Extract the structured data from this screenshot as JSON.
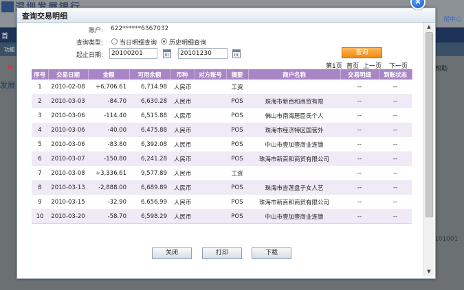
{
  "background": {
    "brand_text": "深圳发展银行",
    "nav_text": "首",
    "sub_text": "功能",
    "left_title": "发展",
    "right_help": "帮助",
    "right_center": "帮中心",
    "right_number": "101001"
  },
  "dialog": {
    "title": "查询交易明细",
    "close_icon": "×"
  },
  "form": {
    "account_label": "账户:",
    "account_value": "622******6367032",
    "query_type_label": "查询类型:",
    "query_type_options": [
      "当日明细查询",
      "历史明细查询"
    ],
    "query_type_selected": "历史明细查询",
    "date_label": "起止日期:",
    "start_date": "20100201",
    "date_separator": "-",
    "end_date": "20101230",
    "query_button": "查询"
  },
  "pager": {
    "current": "第1页",
    "first": "首页",
    "prev": "上一页",
    "next": "下一页"
  },
  "table": {
    "headers": [
      "序号",
      "交易日期",
      "金额",
      "可用余额",
      "币种",
      "对方账号",
      "摘要",
      "商户名称",
      "交易明细",
      "到账状态"
    ],
    "rows": [
      [
        "1",
        "2010-02-08",
        "+6,706.61",
        "6,714.98",
        "人民币",
        "",
        "工资",
        "",
        "--",
        "--"
      ],
      [
        "2",
        "2010-03-03",
        "-84.70",
        "6,630.28",
        "人民币",
        "",
        "POS",
        "珠海市新百和商贸有限",
        "--",
        "--"
      ],
      [
        "3",
        "2010-03-06",
        "-114.40",
        "6,515.88",
        "人民币",
        "",
        "POS",
        "佛山市南海居臣氏个人",
        "--",
        "--"
      ],
      [
        "4",
        "2010-03-06",
        "-40.00",
        "6,475.88",
        "人民币",
        "",
        "POS",
        "珠海市经济特区国营外",
        "--",
        "--"
      ],
      [
        "5",
        "2010-03-06",
        "-83.80",
        "6,392.08",
        "人民币",
        "",
        "POS",
        "中山市壹加壹商业连锁",
        "--",
        "--"
      ],
      [
        "6",
        "2010-03-07",
        "-150.80",
        "6,241.28",
        "人民币",
        "",
        "POS",
        "珠海市新百和商贸有限公司",
        "--",
        "--"
      ],
      [
        "7",
        "2010-03-08",
        "+3,336.61",
        "9,577.89",
        "人民币",
        "",
        "工资",
        "",
        "--",
        "--"
      ],
      [
        "8",
        "2010-03-13",
        "-2,888.00",
        "6,689.89",
        "人民币",
        "",
        "POS",
        "珠海市吉莲盘子女人艺",
        "--",
        "--"
      ],
      [
        "9",
        "2010-03-15",
        "-32.90",
        "6,656.99",
        "人民币",
        "",
        "POS",
        "珠海市新百和商贸有限公司",
        "--",
        "--"
      ],
      [
        "10",
        "2010-03-20",
        "-58.70",
        "6,598.29",
        "人民币",
        "",
        "POS",
        "中山市壹加壹商业连锁",
        "--",
        "--"
      ]
    ]
  },
  "footer": {
    "close_button": "关闭",
    "print_button": "打印",
    "download_button": "下载"
  }
}
